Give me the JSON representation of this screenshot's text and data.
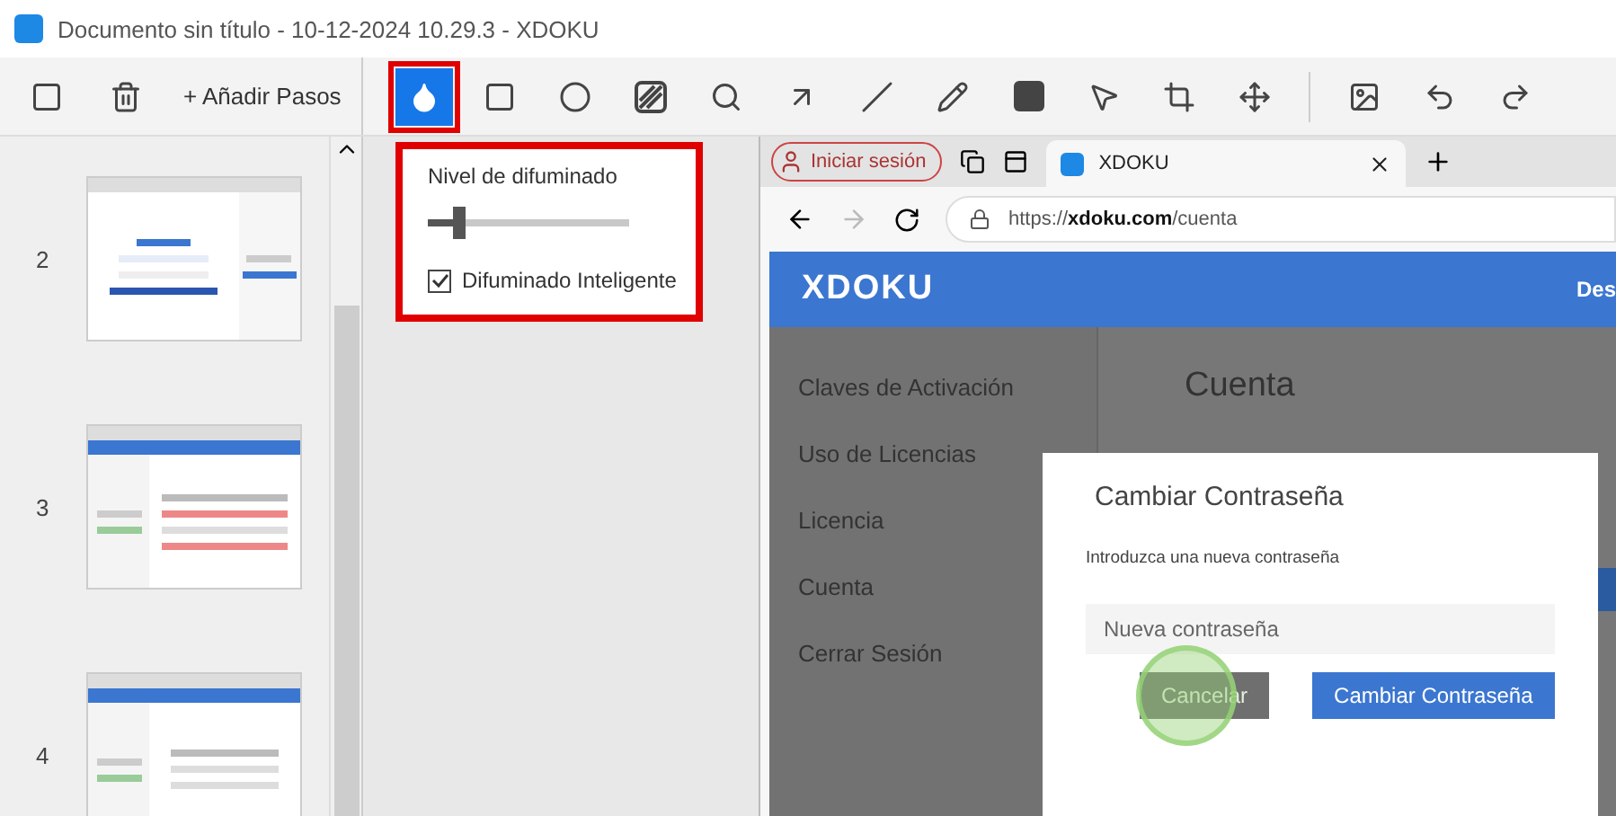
{
  "window": {
    "title": "Documento sin título - 10-12-2024 10.29.3 - XDOKU"
  },
  "toolbar": {
    "add_steps": "+ Añadir Pasos",
    "tools": [
      {
        "kind": "blur",
        "selected": true
      },
      {
        "kind": "rectangle",
        "selected": false
      },
      {
        "kind": "ellipse",
        "selected": false
      },
      {
        "kind": "hatch",
        "selected": false
      },
      {
        "kind": "magnifier",
        "selected": false
      },
      {
        "kind": "arrow",
        "selected": false
      },
      {
        "kind": "line",
        "selected": false
      },
      {
        "kind": "pen",
        "selected": false
      },
      {
        "kind": "text",
        "selected": false
      },
      {
        "kind": "pointer",
        "selected": false
      },
      {
        "kind": "crop",
        "selected": false
      },
      {
        "kind": "move",
        "selected": false
      }
    ],
    "actions": [
      {
        "kind": "image"
      },
      {
        "kind": "undo"
      },
      {
        "kind": "redo"
      }
    ]
  },
  "blur_popup": {
    "label": "Nivel de difuminado",
    "level": 0.15,
    "smart_blur": {
      "label": "Difuminado Inteligente",
      "checked": true
    }
  },
  "steps": [
    {
      "number": "2",
      "kind": "login"
    },
    {
      "number": "3",
      "kind": "table"
    },
    {
      "number": "4",
      "kind": "details"
    }
  ],
  "screenshot": {
    "browser": {
      "sign_in": "Iniciar sesión",
      "tab": "XDOKU",
      "url": "https://**xdoku.com**/cuenta"
    },
    "site": {
      "logo": "XDOKU",
      "nav_cut": "Des",
      "menu": [
        {
          "label": "Claves de Activación"
        },
        {
          "label": "Uso de Licencias"
        },
        {
          "label": "Licencia"
        },
        {
          "label": "Cuenta"
        },
        {
          "label": "Cerrar Sesión"
        }
      ],
      "heading": "Cuenta"
    },
    "dialog": {
      "title": "Cambiar Contraseña",
      "text": "Introduzca una nueva contraseña",
      "placeholder": "Nueva contraseña",
      "cancel": "Cancelar",
      "confirm": "Cambiar Contraseña"
    }
  }
}
